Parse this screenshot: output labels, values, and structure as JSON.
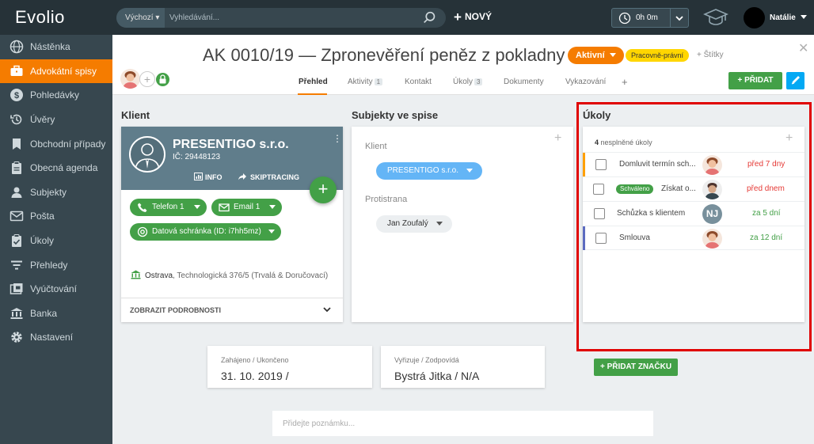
{
  "app": {
    "logo": "Evolio"
  },
  "topbar": {
    "search_scope": "Výchozí",
    "search_placeholder": "Vyhledávání...",
    "new_label": "NOVÝ",
    "timer": "0h 0m",
    "user_name": "Natálie"
  },
  "sidebar": {
    "items": [
      {
        "label": "Nástěnka",
        "icon": "globe-icon"
      },
      {
        "label": "Advokátní spisy",
        "icon": "briefcase-icon",
        "active": true
      },
      {
        "label": "Pohledávky",
        "icon": "money-icon"
      },
      {
        "label": "Úvěry",
        "icon": "history-icon"
      },
      {
        "label": "Obchodní případy",
        "icon": "bookmark-icon"
      },
      {
        "label": "Obecná agenda",
        "icon": "clipboard-icon"
      },
      {
        "label": "Subjekty",
        "icon": "person-icon"
      },
      {
        "label": "Pošta",
        "icon": "mail-icon"
      },
      {
        "label": "Úkoly",
        "icon": "task-icon"
      },
      {
        "label": "Přehledy",
        "icon": "filter-icon"
      },
      {
        "label": "Vyúčtování",
        "icon": "billing-icon"
      },
      {
        "label": "Banka",
        "icon": "bank-icon"
      },
      {
        "label": "Nastavení",
        "icon": "gear-icon"
      }
    ]
  },
  "header": {
    "title": "AK 0010/19 — Zpronevěření peněz z pokladny",
    "status": "Aktivní",
    "tag": "Pracovně-právní",
    "labels_link": "+ Štítky",
    "tabs": [
      {
        "label": "Přehled",
        "active": true
      },
      {
        "label": "Aktivity",
        "count": "1"
      },
      {
        "label": "Kontakt"
      },
      {
        "label": "Úkoly",
        "count": "3"
      },
      {
        "label": "Dokumenty"
      },
      {
        "label": "Vykazování"
      },
      {
        "label": "+"
      }
    ],
    "add_button": "PŘIDAT"
  },
  "client": {
    "section_title": "Klient",
    "name": "PRESENTIGO s.r.o.",
    "ic": "IČ: 29448123",
    "info_label": "INFO",
    "skiptracing_label": "SKIPTRACING",
    "phone": "Telefon 1",
    "email": "Email 1",
    "databox": "Datová schránka (ID: i7hh5mz)",
    "city": "Ostrava",
    "address_rest": ", Technologická 376/5 (Trvalá & Doručovací)",
    "details_label": "ZOBRAZIT PODROBNOSTI"
  },
  "subjects": {
    "section_title": "Subjekty ve spise",
    "client_label": "Klient",
    "client_value": "PRESENTIGO s.r.o.",
    "opponent_label": "Protistrana",
    "opponent_value": "Jan Zoufalý"
  },
  "tasks": {
    "section_title": "Úkoly",
    "count": "4",
    "count_label": " nesplněné úkoly",
    "items": [
      {
        "title": "Domluvit termín sch...",
        "due": "před 7 dny",
        "due_color": "#e53935",
        "bar_color": "#ffa000",
        "avatar": "photo"
      },
      {
        "title": "Získat o...",
        "badge": "Schváleno",
        "due": "před dnem",
        "due_color": "#e53935",
        "bar_color": "",
        "avatar": "photo-dark"
      },
      {
        "title": "Schůzka s klientem",
        "due": "za 5 dní",
        "due_color": "#43a047",
        "bar_color": "",
        "avatar": "NJ"
      },
      {
        "title": "Smlouva",
        "due": "za 12 dní",
        "due_color": "#43a047",
        "bar_color": "#5c6bc0",
        "avatar": "photo"
      }
    ]
  },
  "dates": {
    "started_label": "Zahájeno / Ukončeno",
    "started_value": "31. 10. 2019 /",
    "handler_label": "Vyřizuje / Zodpovídá",
    "handler_value": "Bystrá Jitka / N/A"
  },
  "add_tag_button": "PŘIDAT ZNAČKU",
  "note_placeholder": "Přidejte poznámku...",
  "colors": {
    "accent": "#f57c00",
    "green": "#43a047",
    "sidebar": "#37474f",
    "topbar": "#263238",
    "highlight": "#e00000"
  }
}
